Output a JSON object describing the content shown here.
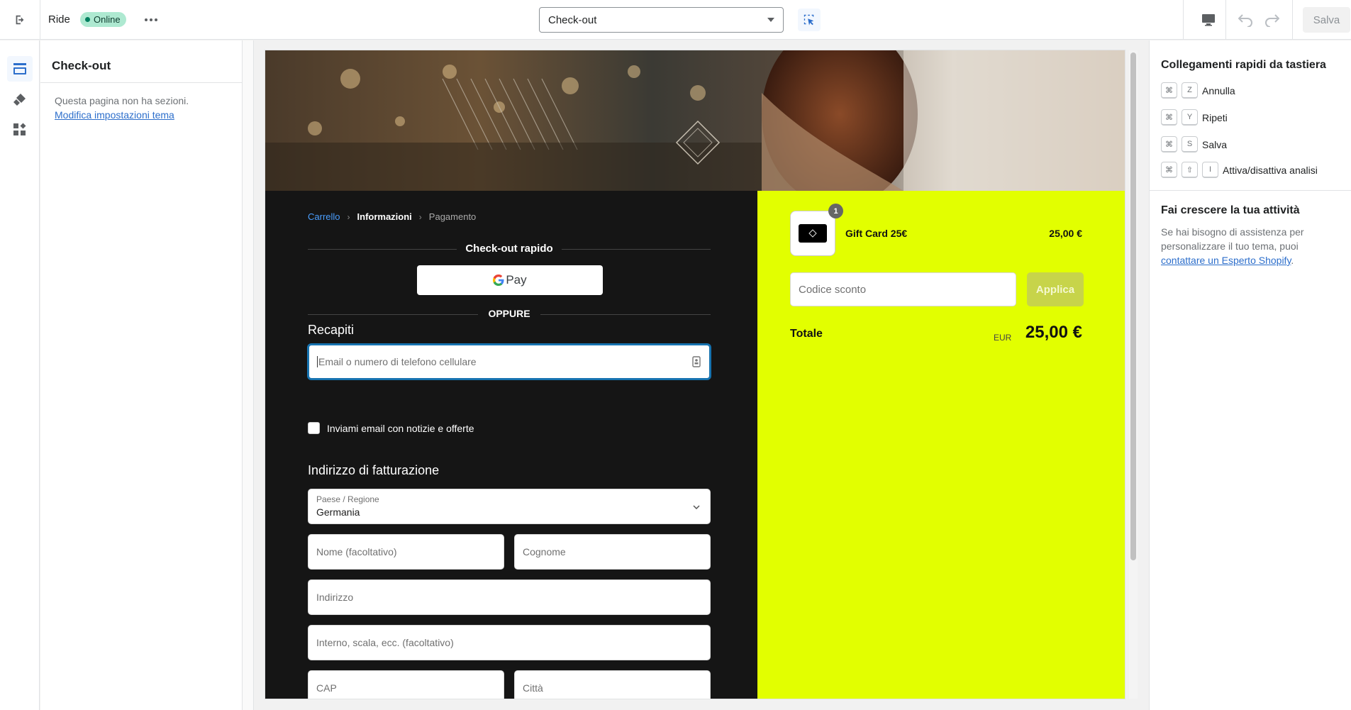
{
  "topbar": {
    "store_name": "Ride",
    "status": "Online",
    "page_select": "Check-out",
    "save_label": "Salva"
  },
  "sidebar": {
    "title": "Check-out",
    "empty_text": "Questa pagina non ha sezioni.",
    "settings_link": "Modifica impostazioni tema"
  },
  "checkout": {
    "breadcrumbs": [
      "Carrello",
      "Informazioni",
      "Pagamento"
    ],
    "express_title": "Check-out rapido",
    "gpay_label": "Pay",
    "or_label": "OPPURE",
    "contact_heading": "Recapiti",
    "email_placeholder": "Email o numero di telefono cellulare",
    "newsletter_label": "Inviami email con notizie e offerte",
    "billing_heading": "Indirizzo di fatturazione",
    "country_label": "Paese / Regione",
    "country_value": "Germania",
    "first_name_placeholder": "Nome (facoltativo)",
    "last_name_placeholder": "Cognome",
    "address_placeholder": "Indirizzo",
    "address2_placeholder": "Interno, scala, ecc. (facoltativo)",
    "zip_placeholder": "CAP",
    "city_placeholder": "Città"
  },
  "summary": {
    "quantity": "1",
    "product_name": "Gift Card 25€",
    "product_price": "25,00 €",
    "discount_placeholder": "Codice sconto",
    "apply_label": "Applica",
    "total_label": "Totale",
    "currency": "EUR",
    "total_value": "25,00 €"
  },
  "right_panel": {
    "shortcuts_title": "Collegamenti rapidi da tastiera",
    "shortcuts": [
      {
        "keys": [
          "⌘",
          "Z"
        ],
        "label": "Annulla"
      },
      {
        "keys": [
          "⌘",
          "Y"
        ],
        "label": "Ripeti"
      },
      {
        "keys": [
          "⌘",
          "S"
        ],
        "label": "Salva"
      },
      {
        "keys": [
          "⌘",
          "⇧",
          "I"
        ],
        "label": "Attiva/disattiva analisi"
      }
    ],
    "grow_title": "Fai crescere la tua attività",
    "grow_text": "Se hai bisogno di assistenza per personalizzare il tuo tema, puoi",
    "grow_link": "contattare un Esperto Shopify"
  },
  "colors": {
    "accent": "#e2ff00",
    "dark": "#151515",
    "link": "#2c6ecb",
    "online": "#aee9d1"
  },
  "icons": [
    "exit-icon",
    "more-icon",
    "chevron-down-icon",
    "inspector-icon",
    "desktop-icon",
    "undo-icon",
    "redo-icon",
    "sections-icon",
    "theme-settings-icon",
    "apps-icon",
    "contact-card-icon",
    "google-g-icon"
  ]
}
